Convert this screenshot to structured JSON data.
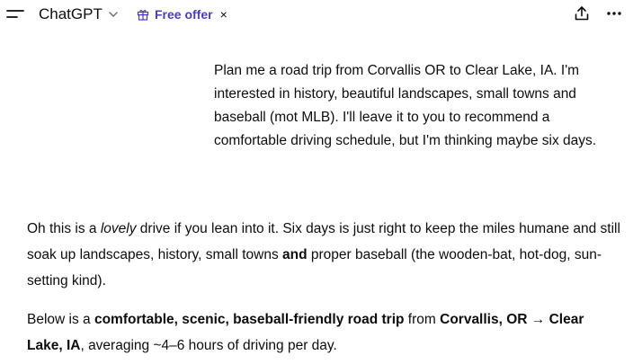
{
  "header": {
    "model_name": "ChatGPT",
    "offer_label": "Free offer",
    "offer_close": "×",
    "icons": [
      "menu-icon",
      "chevron-down-icon",
      "gift-icon",
      "share-icon",
      "more-icon"
    ],
    "offer_color": "#4a3fb5"
  },
  "user_message": {
    "text": "Plan me a road trip from Corvallis OR to Clear Lake, IA. I'm interested in history, beautiful landscapes, small towns and baseball (mot MLB).  I'll leave it to you to recommend a comfortable driving schedule, but I'm thinking maybe six days."
  },
  "assistant": {
    "p1": {
      "a": "Oh this is a ",
      "b": "lovely",
      "c": " drive if you lean into it. Six days is just right to keep the miles humane and still soak up landscapes, history, small towns ",
      "d": "and",
      "e": " proper baseball (the wooden-bat, hot-dog, sun-setting kind)."
    },
    "p2": {
      "a": "Below is a ",
      "b": "comfortable, scenic, baseball-friendly road trip",
      "c": " from ",
      "d": "Corvallis, OR → Clear Lake, IA",
      "e": ", averaging ~4–6 hours of driving per day."
    }
  }
}
